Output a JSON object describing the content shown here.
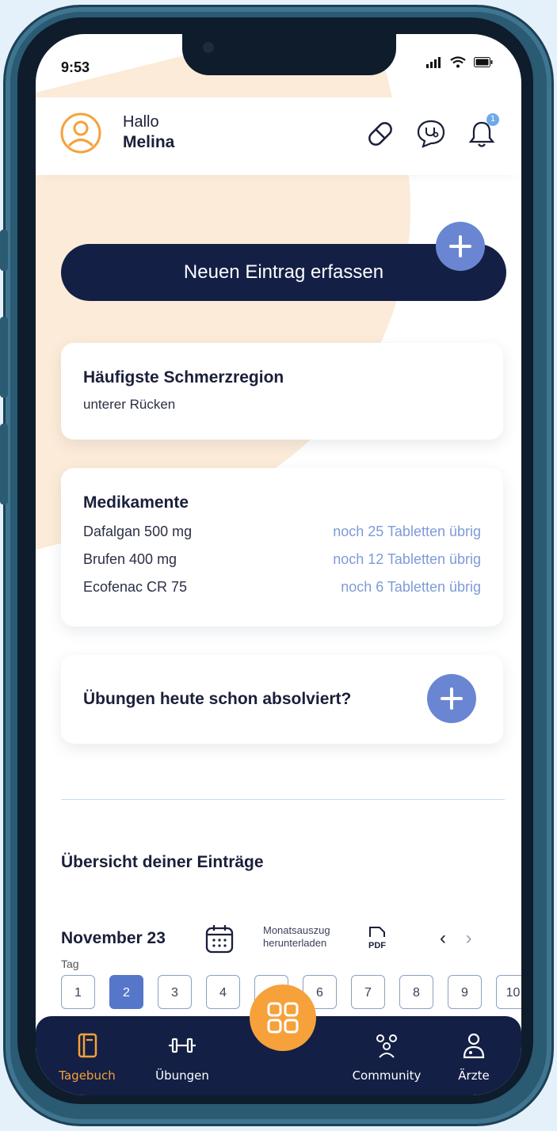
{
  "status": {
    "time": "9:53"
  },
  "header": {
    "greeting": "Hallo",
    "name": "Melina",
    "notification_count": "1"
  },
  "new_entry": {
    "label": "Neuen Eintrag erfassen"
  },
  "pain_card": {
    "title": "Häufigste Schmerzregion",
    "value": "unterer Rücken"
  },
  "meds_card": {
    "title": "Medikamente",
    "items": [
      {
        "name": "Dafalgan 500 mg",
        "remaining": "noch 25 Tabletten übrig"
      },
      {
        "name": "Brufen 400 mg",
        "remaining": "noch 12 Tabletten übrig"
      },
      {
        "name": "Ecofenac CR 75",
        "remaining": "noch 6 Tabletten übrig"
      }
    ]
  },
  "exercise_card": {
    "title": "Übungen heute schon absolviert?"
  },
  "overview": {
    "title": "Übersicht deiner Einträge",
    "month": "November 23",
    "pdf_line1": "Monatsauszug",
    "pdf_line2": "herunterladen",
    "pdf_badge": "PDF",
    "prev": "‹",
    "next": "›",
    "day_label": "Tag",
    "days": [
      "1",
      "2",
      "3",
      "4",
      "5",
      "6",
      "7",
      "8",
      "9",
      "10"
    ],
    "selected_day": "2"
  },
  "tabs": {
    "diary": "Tagebuch",
    "exercises": "Übungen",
    "community": "Community",
    "doctors": "Ärzte"
  },
  "colors": {
    "navy": "#131f45",
    "orange": "#f6a13a",
    "accent_blue": "#6a86d3"
  }
}
